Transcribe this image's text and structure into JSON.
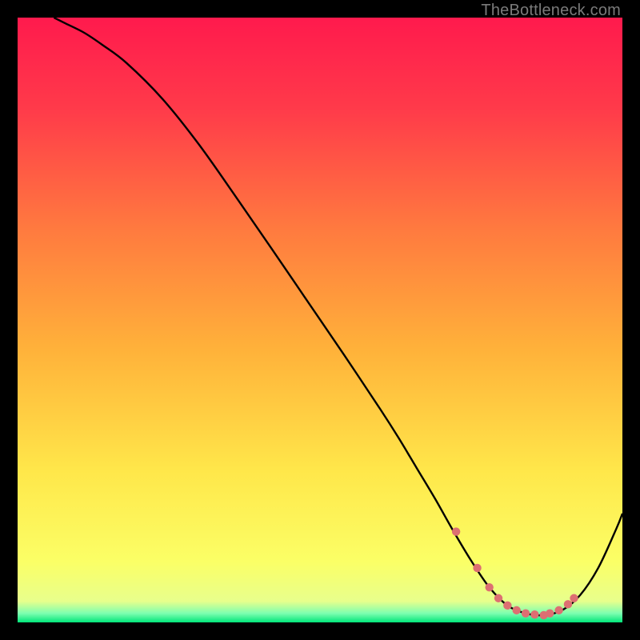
{
  "watermark": "TheBottleneck.com",
  "chart_data": {
    "type": "line",
    "title": "",
    "xlabel": "",
    "ylabel": "",
    "xlim": [
      0,
      100
    ],
    "ylim": [
      0,
      100
    ],
    "background_gradient": {
      "stops": [
        {
          "pos": 0.0,
          "color": "#ff1a4d"
        },
        {
          "pos": 0.15,
          "color": "#ff3a4a"
        },
        {
          "pos": 0.35,
          "color": "#ff7a3f"
        },
        {
          "pos": 0.55,
          "color": "#ffb23a"
        },
        {
          "pos": 0.75,
          "color": "#ffe74a"
        },
        {
          "pos": 0.9,
          "color": "#fbff66"
        },
        {
          "pos": 0.965,
          "color": "#e8ff8c"
        },
        {
          "pos": 0.985,
          "color": "#7dffb0"
        },
        {
          "pos": 1.0,
          "color": "#00e57a"
        }
      ]
    },
    "curve": {
      "name": "bottleneck-curve",
      "x": [
        6,
        8,
        11,
        14,
        18,
        24,
        30,
        36,
        42,
        48,
        54,
        60,
        63,
        66,
        69,
        72,
        75,
        78,
        81,
        84,
        87,
        90,
        93,
        96,
        99,
        100
      ],
      "y": [
        100,
        99,
        97.5,
        95.5,
        92.5,
        86.5,
        79,
        70.5,
        61.8,
        53,
        44.2,
        35.2,
        30.5,
        25.5,
        20.5,
        15.2,
        10.2,
        5.8,
        2.8,
        1.5,
        1.2,
        2.0,
        4.5,
        9.0,
        15.5,
        18.0
      ]
    },
    "marked_points": {
      "name": "optimal-range-points",
      "color": "#dd6f72",
      "x": [
        72.5,
        76.0,
        78.0,
        79.5,
        81.0,
        82.5,
        84.0,
        85.5,
        87.0,
        88.0,
        89.5,
        91.0,
        92.0
      ],
      "y": [
        15.0,
        9.0,
        5.8,
        4.0,
        2.8,
        2.0,
        1.5,
        1.3,
        1.2,
        1.5,
        2.0,
        3.0,
        4.0
      ]
    }
  }
}
